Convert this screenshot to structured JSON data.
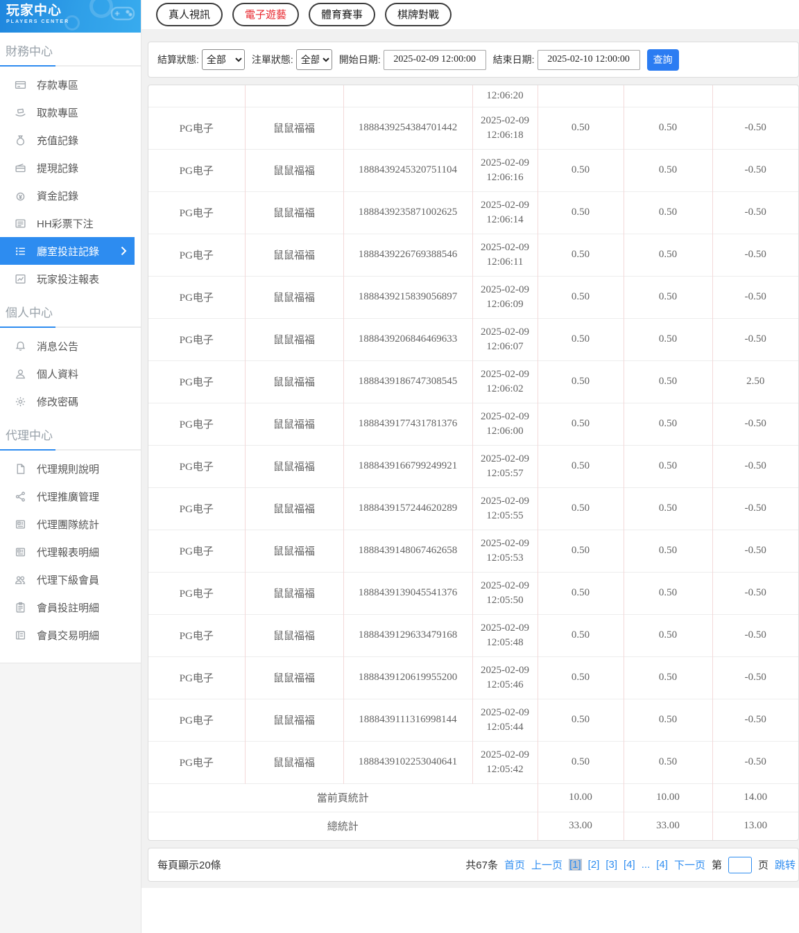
{
  "sidebar": {
    "logo": {
      "title": "玩家中心",
      "subtitle": "PLAYERS CENTER"
    },
    "sections": [
      {
        "header": "財務中心",
        "items": [
          {
            "label": "存款專區",
            "icon": "deposit-icon"
          },
          {
            "label": "取款專區",
            "icon": "withdraw-icon"
          },
          {
            "label": "充值記錄",
            "icon": "recharge-record-icon"
          },
          {
            "label": "提現記錄",
            "icon": "cashout-record-icon"
          },
          {
            "label": "資金記錄",
            "icon": "funds-record-icon"
          },
          {
            "label": "HH彩票下注",
            "icon": "lottery-icon"
          },
          {
            "label": "廳室投註記錄",
            "icon": "bet-records-icon",
            "active": true
          },
          {
            "label": "玩家投注報表",
            "icon": "player-report-icon"
          }
        ]
      },
      {
        "header": "個人中心",
        "items": [
          {
            "label": "消息公告",
            "icon": "bell-icon"
          },
          {
            "label": "個人資料",
            "icon": "profile-icon"
          },
          {
            "label": "修改密碼",
            "icon": "gear-icon"
          }
        ]
      },
      {
        "header": "代理中心",
        "items": [
          {
            "label": "代理規則說明",
            "icon": "doc-icon"
          },
          {
            "label": "代理推廣管理",
            "icon": "share-icon"
          },
          {
            "label": "代理團隊統計",
            "icon": "team-stats-icon"
          },
          {
            "label": "代理報表明細",
            "icon": "report-detail-icon"
          },
          {
            "label": "代理下級會員",
            "icon": "members-icon"
          },
          {
            "label": "會員投註明細",
            "icon": "member-bets-icon"
          },
          {
            "label": "會員交易明細",
            "icon": "member-trans-icon"
          }
        ]
      }
    ]
  },
  "tabs": [
    {
      "label": "真人視訊",
      "active": false
    },
    {
      "label": "電子遊藝",
      "active": true
    },
    {
      "label": "體育賽事",
      "active": false
    },
    {
      "label": "棋牌對戰",
      "active": false
    }
  ],
  "filters": {
    "settle_label": "結算狀態:",
    "settle_value": "全部",
    "order_label": "注單狀態:",
    "order_value": "全部",
    "start_label": "開始日期:",
    "start_value": "2025-02-09 12:00:00",
    "end_label": "結束日期:",
    "end_value": "2025-02-10 12:00:00",
    "search_label": "查詢"
  },
  "table": {
    "partial_row_time": "12:06:20",
    "rows": [
      {
        "vendor": "PG电子",
        "game": "鼠鼠福福",
        "order": "1888439254384701442",
        "date": "2025-02-09",
        "time": "12:06:18",
        "bet": "0.50",
        "valid": "0.50",
        "winloss": "-0.50"
      },
      {
        "vendor": "PG电子",
        "game": "鼠鼠福福",
        "order": "1888439245320751104",
        "date": "2025-02-09",
        "time": "12:06:16",
        "bet": "0.50",
        "valid": "0.50",
        "winloss": "-0.50"
      },
      {
        "vendor": "PG电子",
        "game": "鼠鼠福福",
        "order": "1888439235871002625",
        "date": "2025-02-09",
        "time": "12:06:14",
        "bet": "0.50",
        "valid": "0.50",
        "winloss": "-0.50"
      },
      {
        "vendor": "PG电子",
        "game": "鼠鼠福福",
        "order": "1888439226769388546",
        "date": "2025-02-09",
        "time": "12:06:11",
        "bet": "0.50",
        "valid": "0.50",
        "winloss": "-0.50"
      },
      {
        "vendor": "PG电子",
        "game": "鼠鼠福福",
        "order": "1888439215839056897",
        "date": "2025-02-09",
        "time": "12:06:09",
        "bet": "0.50",
        "valid": "0.50",
        "winloss": "-0.50"
      },
      {
        "vendor": "PG电子",
        "game": "鼠鼠福福",
        "order": "1888439206846469633",
        "date": "2025-02-09",
        "time": "12:06:07",
        "bet": "0.50",
        "valid": "0.50",
        "winloss": "-0.50"
      },
      {
        "vendor": "PG电子",
        "game": "鼠鼠福福",
        "order": "1888439186747308545",
        "date": "2025-02-09",
        "time": "12:06:02",
        "bet": "0.50",
        "valid": "0.50",
        "winloss": "2.50"
      },
      {
        "vendor": "PG电子",
        "game": "鼠鼠福福",
        "order": "1888439177431781376",
        "date": "2025-02-09",
        "time": "12:06:00",
        "bet": "0.50",
        "valid": "0.50",
        "winloss": "-0.50"
      },
      {
        "vendor": "PG电子",
        "game": "鼠鼠福福",
        "order": "1888439166799249921",
        "date": "2025-02-09",
        "time": "12:05:57",
        "bet": "0.50",
        "valid": "0.50",
        "winloss": "-0.50"
      },
      {
        "vendor": "PG电子",
        "game": "鼠鼠福福",
        "order": "1888439157244620289",
        "date": "2025-02-09",
        "time": "12:05:55",
        "bet": "0.50",
        "valid": "0.50",
        "winloss": "-0.50"
      },
      {
        "vendor": "PG电子",
        "game": "鼠鼠福福",
        "order": "1888439148067462658",
        "date": "2025-02-09",
        "time": "12:05:53",
        "bet": "0.50",
        "valid": "0.50",
        "winloss": "-0.50"
      },
      {
        "vendor": "PG电子",
        "game": "鼠鼠福福",
        "order": "1888439139045541376",
        "date": "2025-02-09",
        "time": "12:05:50",
        "bet": "0.50",
        "valid": "0.50",
        "winloss": "-0.50"
      },
      {
        "vendor": "PG电子",
        "game": "鼠鼠福福",
        "order": "1888439129633479168",
        "date": "2025-02-09",
        "time": "12:05:48",
        "bet": "0.50",
        "valid": "0.50",
        "winloss": "-0.50"
      },
      {
        "vendor": "PG电子",
        "game": "鼠鼠福福",
        "order": "1888439120619955200",
        "date": "2025-02-09",
        "time": "12:05:46",
        "bet": "0.50",
        "valid": "0.50",
        "winloss": "-0.50"
      },
      {
        "vendor": "PG电子",
        "game": "鼠鼠福福",
        "order": "1888439111316998144",
        "date": "2025-02-09",
        "time": "12:05:44",
        "bet": "0.50",
        "valid": "0.50",
        "winloss": "-0.50"
      },
      {
        "vendor": "PG电子",
        "game": "鼠鼠福福",
        "order": "1888439102253040641",
        "date": "2025-02-09",
        "time": "12:05:42",
        "bet": "0.50",
        "valid": "0.50",
        "winloss": "-0.50"
      }
    ],
    "summary": [
      {
        "label": "當前頁統計",
        "bet": "10.00",
        "valid": "10.00",
        "winloss": "14.00"
      },
      {
        "label": "總統計",
        "bet": "33.00",
        "valid": "33.00",
        "winloss": "13.00"
      }
    ]
  },
  "pagination": {
    "page_size_text": "每頁顯示20條",
    "total_text": "共67条",
    "first": "首页",
    "prev": "上一页",
    "pages": [
      {
        "label": "[1]",
        "current": true
      },
      {
        "label": "[2]",
        "current": false
      },
      {
        "label": "[3]",
        "current": false
      },
      {
        "label": "[4]",
        "current": false
      },
      {
        "label": "...",
        "current": false
      },
      {
        "label": "[4]",
        "current": false
      }
    ],
    "next": "下一页",
    "jump_prefix": "第",
    "jump_suffix": "页",
    "jump_label": "跳转",
    "jump_value": ""
  },
  "colors": {
    "accent_blue": "#2d8cf0",
    "active_tab_red": "#e8262d",
    "search_button_blue": "#2b7cf2",
    "current_page_bg": "#bfc7d3",
    "table_vertical_border": "#f3d9d9",
    "table_horizontal_border": "#ededed",
    "logo_gradient_start": "#1f86de",
    "logo_gradient_end": "#38abee"
  }
}
